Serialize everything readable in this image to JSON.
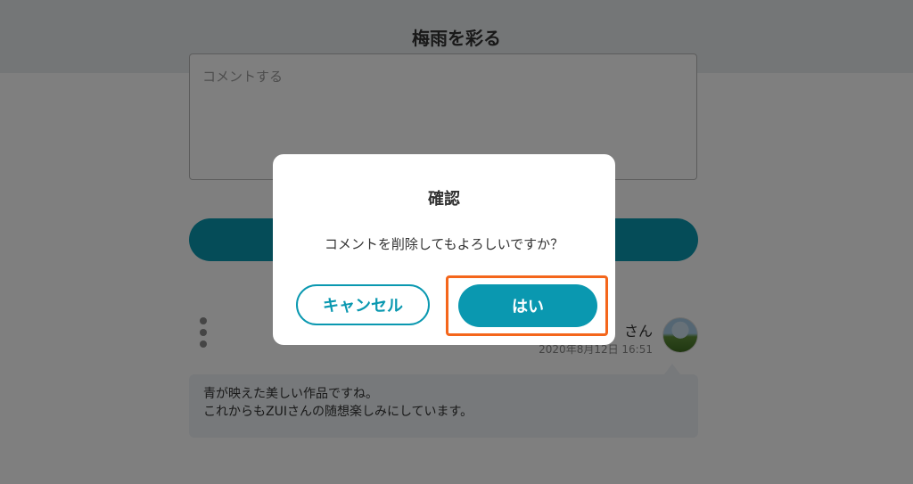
{
  "header": {
    "title": "梅雨を彩る"
  },
  "comment_form": {
    "placeholder": "コメントする"
  },
  "comment": {
    "author": "さん",
    "date": "2020年8月12日 16:51",
    "lines": [
      "青が映えた美しい作品ですね。",
      "これからもZUIさんの随想楽しみにしています。"
    ]
  },
  "dialog": {
    "title": "確認",
    "message": "コメントを削除してもよろしいですか？",
    "cancel_label": "キャンセル",
    "confirm_label": "はい"
  },
  "colors": {
    "accent": "#0a98b0",
    "highlight": "#f4661b"
  }
}
